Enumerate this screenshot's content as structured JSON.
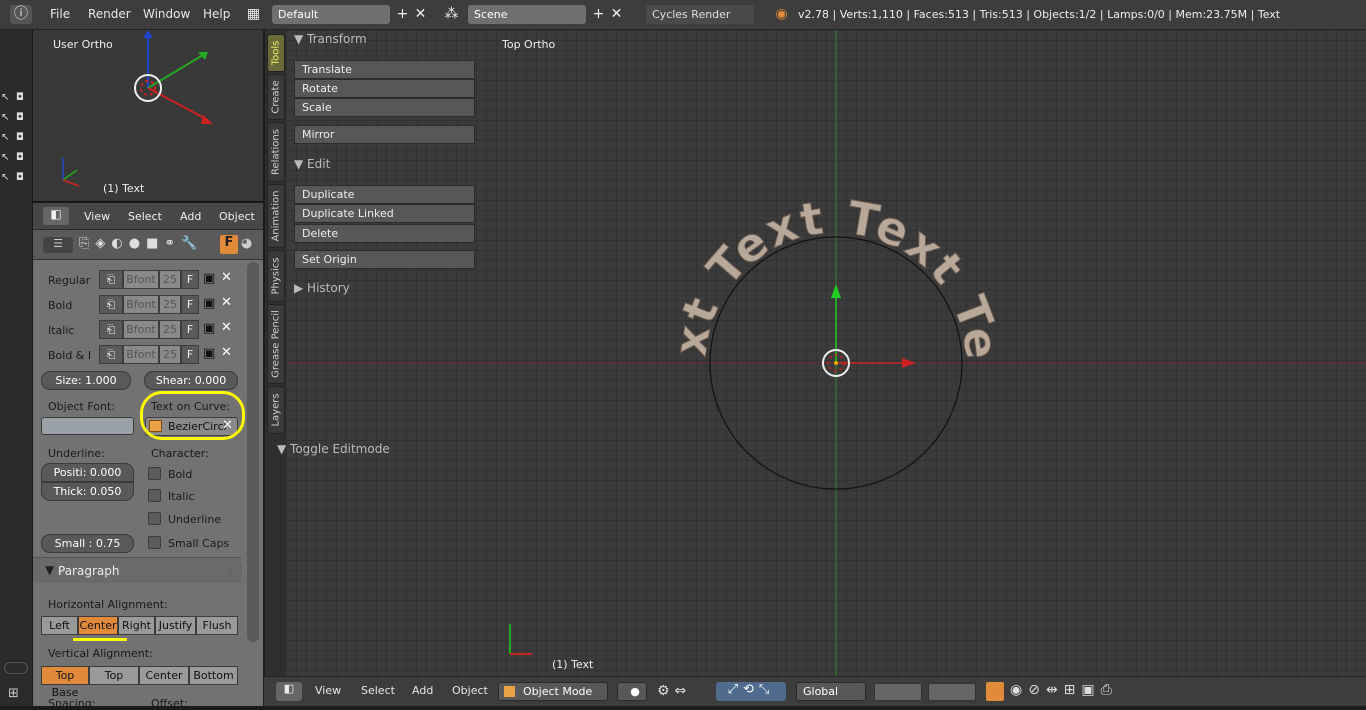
{
  "topbar": {
    "menus": [
      "File",
      "Render",
      "Window",
      "Help"
    ],
    "screen_layout": "Default",
    "scene": "Scene",
    "render_engine": "Cycles Render",
    "stats": "v2.78 | Verts:1,110 | Faces:513 | Tris:513 | Objects:1/2 | Lamps:0/0 | Mem:23.75M | Text"
  },
  "mini_view": {
    "label": "User Ortho",
    "object_label": "(1) Text"
  },
  "properties": {
    "header_menus": [
      "View",
      "Select",
      "Add",
      "Object"
    ],
    "fonts": [
      {
        "label": "Regular",
        "font": "Bfont",
        "users": "25",
        "fake": "F"
      },
      {
        "label": "Bold",
        "font": "Bfont",
        "users": "25",
        "fake": "F"
      },
      {
        "label": "Italic",
        "font": "Bfont",
        "users": "25",
        "fake": "F"
      },
      {
        "label": "Bold & I",
        "font": "Bfont",
        "users": "25",
        "fake": "F"
      }
    ],
    "size": "Size:  1.000",
    "shear": "Shear: 0.000",
    "object_font_label": "Object Font:",
    "text_on_curve_label": "Text on Curve:",
    "text_on_curve_value": "BezierCircl",
    "underline_label": "Underline:",
    "underline_position": "Positi: 0.000",
    "underline_thickness": "Thick: 0.050",
    "character_label": "Character:",
    "character_options": [
      "Bold",
      "Italic",
      "Underline",
      "Small Caps"
    ],
    "small_caps_scale": "Small :  0.75",
    "paragraph_label": "Paragraph",
    "horizontal_alignment_label": "Horizontal Alignment:",
    "horizontal_alignment": [
      "Left",
      "Center",
      "Right",
      "Justify",
      "Flush"
    ],
    "horizontal_selected": "Center",
    "vertical_alignment_label": "Vertical Alignment:",
    "vertical_alignment": [
      "Top Base",
      "Top",
      "Center",
      "Bottom"
    ],
    "vertical_selected": "Top Base",
    "spacing_label": "Spacing:",
    "offset_label": "Offset:"
  },
  "shelf_tabs": [
    "Tools",
    "Create",
    "Relations",
    "Animation",
    "Physics",
    "Grease Pencil",
    "Layers"
  ],
  "tool_panel": {
    "transform_header": "Transform",
    "transform_buttons": [
      "Translate",
      "Rotate",
      "Scale"
    ],
    "mirror": "Mirror",
    "edit_header": "Edit",
    "edit_buttons": [
      "Duplicate",
      "Duplicate Linked",
      "Delete"
    ],
    "set_origin": "Set Origin",
    "history_header": "History",
    "toggle_editmode": "Toggle Editmode"
  },
  "viewport": {
    "label": "Top Ortho",
    "object_label": "(1) Text",
    "curve_text": "Text Text Text Text"
  },
  "bottombar": {
    "menus": [
      "View",
      "Select",
      "Add",
      "Object"
    ],
    "mode": "Object Mode",
    "orientation": "Global"
  },
  "colors": {
    "highlight": "#ffff00",
    "selected_button": "#e08a3a",
    "x_axis": "#cc2222",
    "y_axis": "#22aa22",
    "z_axis": "#2244cc"
  }
}
